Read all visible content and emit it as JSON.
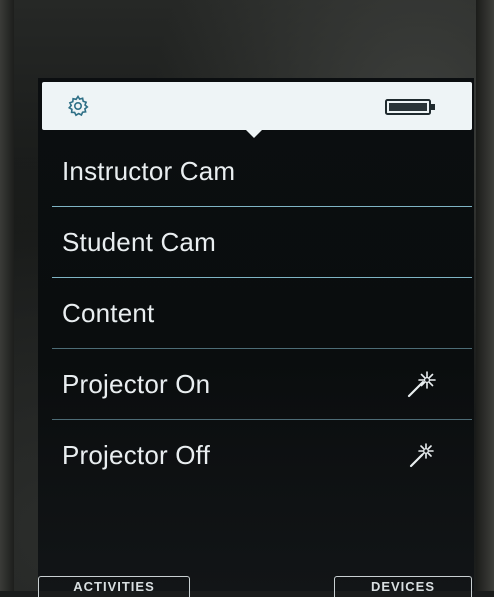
{
  "header": {
    "settings_icon": "gear-icon",
    "battery_icon": "battery-icon"
  },
  "menu": {
    "items": [
      {
        "label": "Instructor Cam"
      },
      {
        "label": "Student Cam"
      },
      {
        "label": "Content"
      },
      {
        "label": "Projector On",
        "icon": "magic-wand-icon"
      },
      {
        "label": "Projector Off",
        "icon": "magic-wand-icon"
      }
    ]
  },
  "footer": {
    "left_label": "ACTIVITIES",
    "right_label": "DEVICES"
  },
  "colors": {
    "topbar": "#eef4f6",
    "accent": "#7fb4c4",
    "text": "#e9eef0",
    "screen": "#0b0e10"
  }
}
